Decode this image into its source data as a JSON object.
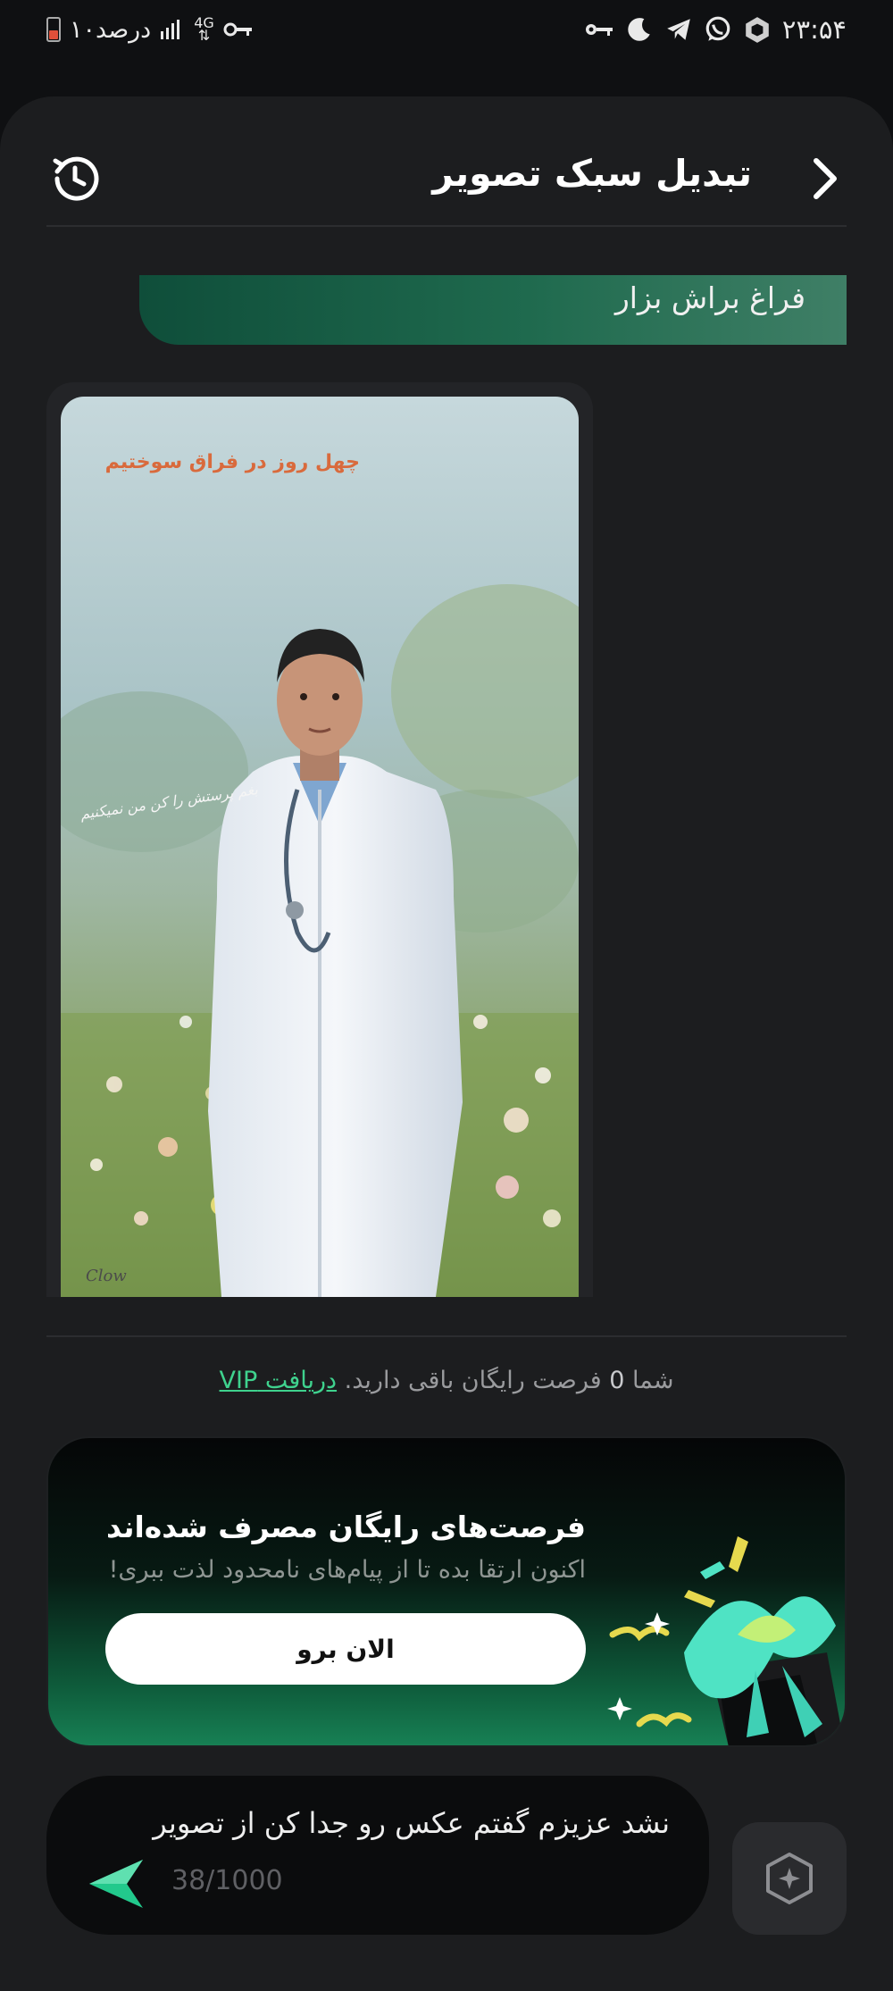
{
  "status_bar": {
    "time": "۲۳:۵۴",
    "battery_text": "۱۰درصد",
    "network": "4G",
    "icons_right": [
      "key-icon",
      "moon-icon",
      "telegram-icon",
      "whatsapp-icon",
      "hexagon-app-icon"
    ],
    "icons_left": [
      "battery-icon",
      "signal-icon",
      "network-4g-icon",
      "vpn-key-icon"
    ]
  },
  "header": {
    "title": "تبدیل سبک تصویر",
    "back_icon": "chevron-right-icon",
    "history_icon": "history-icon"
  },
  "chat": {
    "user_message": "فراغ براش بزار",
    "image": {
      "caption_top": "چهل روز در فراق سوختیم",
      "caption_middle": "بغم پرستش را کن من نمیکنیم",
      "signature": "Clow"
    }
  },
  "quota": {
    "prefix": "شما",
    "count": "0",
    "suffix": "فرصت رایگان باقی دارید.",
    "vip_link": "دریافت VIP"
  },
  "promo": {
    "title": "فرصت‌های رایگان مصرف شده‌اند",
    "subtitle": "اکنون ارتقا بده تا از پیام‌های نامحدود لذت ببری!",
    "button": "الان برو",
    "accent_color": "#3fd28e"
  },
  "composer": {
    "text": "نشد عزیزم گفتم عکس رو جدا کن از تصویر",
    "counter": "38/1000",
    "send_icon": "send-icon",
    "magic_icon": "sparkle-cube-icon"
  }
}
